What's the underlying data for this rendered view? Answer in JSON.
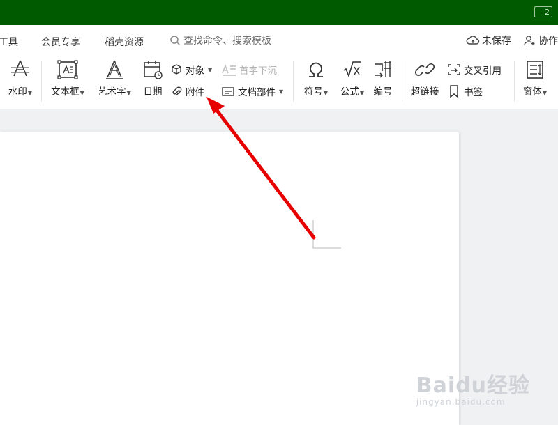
{
  "titlebar": {
    "badge": "2"
  },
  "menubar": {
    "items": [
      "工具",
      "会员专享",
      "稻壳资源"
    ],
    "search_label": "查找命令、搜索模板",
    "save_status": "未保存",
    "collab": "协作"
  },
  "ribbon": {
    "watermark": "水印",
    "textbox": "文本框",
    "wordart": "艺术字",
    "date": "日期",
    "object": "对象",
    "attachment": "附件",
    "dropcap": "首字下沉",
    "docparts": "文档部件",
    "symbol": "符号",
    "formula": "公式",
    "numbering": "编号",
    "hyperlink": "超链接",
    "crossref": "交叉引用",
    "bookmark": "书签",
    "window": "窗体"
  },
  "watermark_text": {
    "logo": "Baidu经验",
    "url": "jingyan.baidu.com"
  },
  "colors": {
    "titlebar": "#005a00",
    "arrow": "#e60000"
  }
}
